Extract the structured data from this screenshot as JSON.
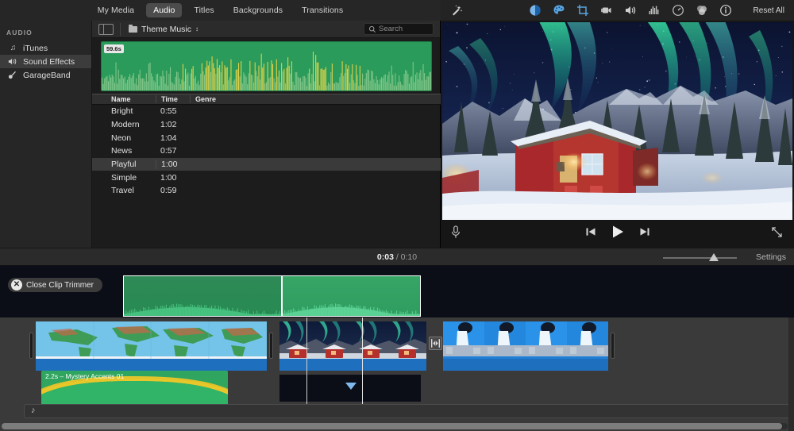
{
  "topbar": {
    "tabs": [
      {
        "label": "My Media",
        "active": false
      },
      {
        "label": "Audio",
        "active": true
      },
      {
        "label": "Titles",
        "active": false
      },
      {
        "label": "Backgrounds",
        "active": false
      },
      {
        "label": "Transitions",
        "active": false
      }
    ],
    "wand_icon": "magic-wand-icon",
    "inspector_icons": [
      "color-balance-icon",
      "color-correction-icon",
      "crop-icon",
      "stabilization-icon",
      "volume-icon",
      "noise-reduction-icon",
      "speed-icon",
      "filters-icon",
      "info-icon"
    ],
    "reset_all": "Reset All"
  },
  "sidebar": {
    "header": "AUDIO",
    "items": [
      {
        "label": "iTunes",
        "icon": "music-note-icon",
        "selected": false
      },
      {
        "label": "Sound Effects",
        "icon": "speaker-icon",
        "selected": true
      },
      {
        "label": "GarageBand",
        "icon": "guitar-icon",
        "selected": false
      }
    ]
  },
  "browser": {
    "sidebar_toggle": "sidebar-toggle-icon",
    "source_label": "Theme Music",
    "search_placeholder": "Search",
    "preview": {
      "duration_badge": "59.6s",
      "waveform_color": "#2a9b5a",
      "peak_color": "#e8d44a"
    },
    "columns": [
      "Name",
      "Time",
      "Genre"
    ],
    "rows": [
      {
        "name": "Bright",
        "time": "0:55",
        "genre": "",
        "selected": false
      },
      {
        "name": "Modern",
        "time": "1:02",
        "genre": "",
        "selected": false
      },
      {
        "name": "Neon",
        "time": "1:04",
        "genre": "",
        "selected": false
      },
      {
        "name": "News",
        "time": "0:57",
        "genre": "",
        "selected": false
      },
      {
        "name": "Playful",
        "time": "1:00",
        "genre": "",
        "selected": true
      },
      {
        "name": "Simple",
        "time": "1:00",
        "genre": "",
        "selected": false
      },
      {
        "name": "Travel",
        "time": "0:59",
        "genre": "",
        "selected": false
      }
    ]
  },
  "viewer": {
    "scene_description": "aurora borealis over red cabin in snowy mountains",
    "mic_icon": "microphone-icon",
    "prev_icon": "skip-previous-icon",
    "play_icon": "play-icon",
    "next_icon": "skip-next-icon",
    "expand_icon": "fullscreen-icon"
  },
  "timecode": {
    "current": "0:03",
    "separator": "/",
    "total": "0:10",
    "settings_label": "Settings",
    "zoom_value": 62
  },
  "trimmer": {
    "close_label": "Close Clip Trimmer",
    "close_icon": "close-circle-icon",
    "segments": [
      {
        "name": "trim-segment-left",
        "color": "#2e8a56"
      },
      {
        "name": "trim-segment-right",
        "color": "#36a566"
      }
    ]
  },
  "timeline": {
    "clips": [
      {
        "name": "world-map-clip",
        "kind": "video"
      },
      {
        "name": "aurora-cabin-clip",
        "kind": "video"
      },
      {
        "name": "waterfall-clip",
        "kind": "video"
      }
    ],
    "audio_clip": {
      "label": "2.2s – Mystery Accents 01",
      "color": "#2fa55f",
      "peak_color": "#e8c72a"
    },
    "transition_icon": "transition-icon",
    "music_track_icon": "music-note-icon"
  }
}
